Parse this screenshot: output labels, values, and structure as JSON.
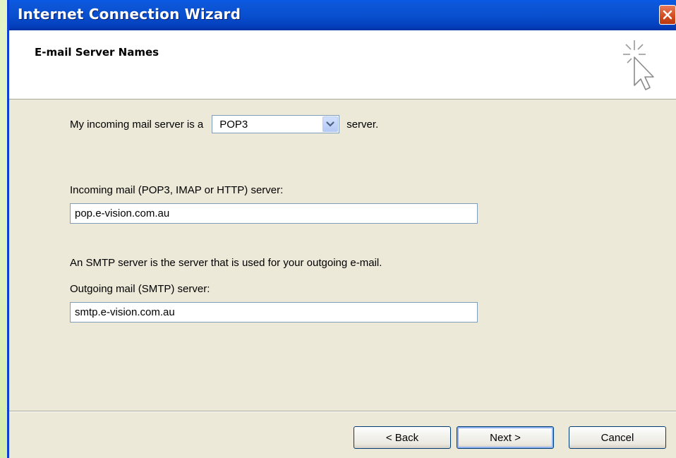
{
  "window": {
    "title": "Internet Connection Wizard",
    "close_icon": "close-icon"
  },
  "header": {
    "title": "E-mail Server Names",
    "icon": "wizard-sparkle-cursor-icon"
  },
  "server_type": {
    "prefix": "My incoming mail server is a",
    "selected": "POP3",
    "suffix": "server."
  },
  "incoming": {
    "label": "Incoming mail (POP3, IMAP or HTTP) server:",
    "value": "pop.e-vision.com.au"
  },
  "smtp_note": "An SMTP server is the server that is used for your outgoing e-mail.",
  "outgoing": {
    "label": "Outgoing mail (SMTP) server:",
    "value": "smtp.e-vision.com.au"
  },
  "buttons": {
    "back": "< Back",
    "next": "Next >",
    "cancel": "Cancel"
  },
  "colors": {
    "titlebar": "#0850d0",
    "dialog_bg": "#ece9d8",
    "close_button": "#d24a1e"
  }
}
